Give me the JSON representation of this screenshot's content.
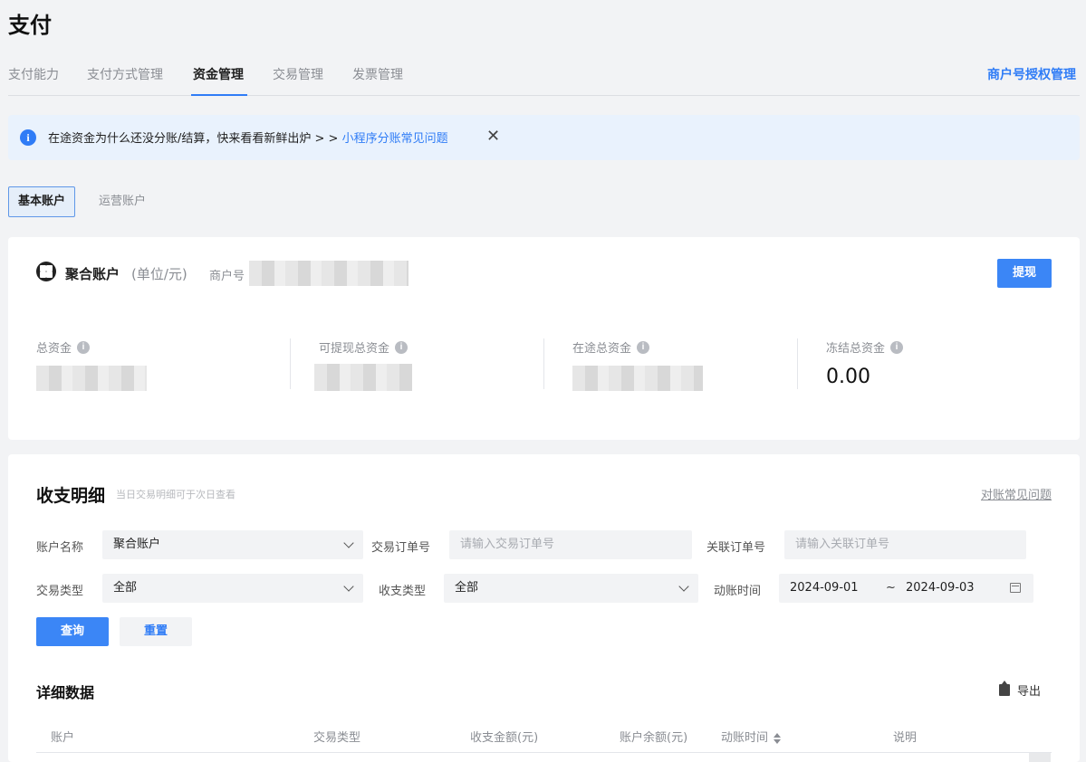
{
  "page": {
    "title": "支付"
  },
  "tabs": [
    {
      "label": "支付能力",
      "active": false
    },
    {
      "label": "支付方式管理",
      "active": false
    },
    {
      "label": "资金管理",
      "active": true
    },
    {
      "label": "交易管理",
      "active": false
    },
    {
      "label": "发票管理",
      "active": false
    }
  ],
  "header": {
    "auth_link": "商户号授权管理"
  },
  "notice": {
    "icon": "info-icon",
    "text": "在途资金为什么还没分账/结算，快来看看新鲜出炉 > > ",
    "link": "小程序分账常见问题",
    "close_icon": "close-icon"
  },
  "account_tabs": [
    {
      "label": "基本账户",
      "active": true
    },
    {
      "label": "运营账户",
      "active": false
    }
  ],
  "summary": {
    "title": "聚合账户",
    "unit": "(单位/元)",
    "merchant_label": "商户号",
    "withdraw_button": "提现",
    "stats": [
      {
        "label": "总资金",
        "value": null
      },
      {
        "label": "可提现总资金",
        "value": null
      },
      {
        "label": "在途总资金",
        "value": null
      },
      {
        "label": "冻结总资金",
        "value": "0.00"
      }
    ]
  },
  "ledger": {
    "title": "收支明细",
    "hint": "当日交易明细可于次日查看",
    "faq_link": "对账常见问题",
    "filters": {
      "account_name_label": "账户名称",
      "account_name_value": "聚合账户",
      "order_no_label": "交易订单号",
      "order_no_placeholder": "请输入交易订单号",
      "related_no_label": "关联订单号",
      "related_no_placeholder": "请输入关联订单号",
      "trade_type_label": "交易类型",
      "trade_type_value": "全部",
      "io_type_label": "收支类型",
      "io_type_value": "全部",
      "posting_time_label": "动账时间",
      "date_start": "2024-09-01",
      "date_sep": "~",
      "date_end": "2024-09-03"
    },
    "query_button": "查询",
    "reset_button": "重置",
    "detail_title": "详细数据",
    "export_label": "导出",
    "columns": [
      "账户",
      "交易类型",
      "收支金额(元)",
      "账户余额(元)",
      "动账时间",
      "说明"
    ]
  }
}
